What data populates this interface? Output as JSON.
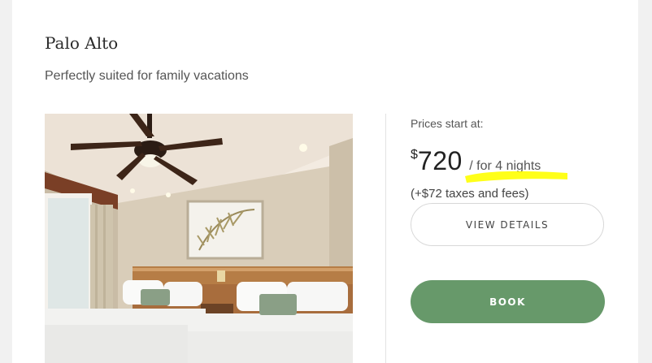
{
  "listing": {
    "title": "Palo Alto",
    "subtitle": "Perfectly suited for family vacations"
  },
  "pricing": {
    "label": "Prices start at:",
    "currency": "$",
    "amount": "720",
    "per_stay": "/ for 4 nights",
    "taxes": "(+$72 taxes and fees)"
  },
  "actions": {
    "details_label": "VIEW DETAILS",
    "book_label": "BOOK"
  },
  "colors": {
    "book_button": "#67996a",
    "highlight": "#ffff00"
  }
}
